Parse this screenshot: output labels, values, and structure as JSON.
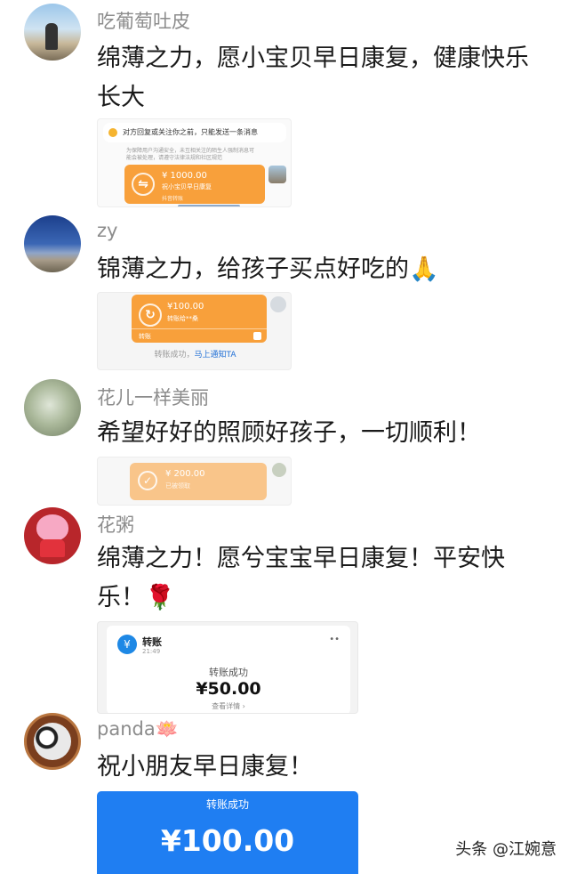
{
  "comments": [
    {
      "username": "吃葡萄吐皮",
      "text": "绵薄之力，愿小宝贝早日康复，健康快乐长大",
      "screenshot": {
        "notice": "对方回复或关注你之前，只能发送一条消息",
        "warning_line1": "为保障用户沟通安全，未互相关注的陌生人强制消息可",
        "warning_line2": "能会被处理，请遵守法律法规和社区规范",
        "amount": "¥ 1000.00",
        "note": "祝小宝贝早日康复",
        "status": "抖音转账"
      }
    },
    {
      "username": "zy",
      "text": "锦薄之力，给孩子买点好吃的🙏",
      "screenshot": {
        "amount": "¥100.00",
        "note": "转账给**桑",
        "type": "转账",
        "result": "转账成功，",
        "notify_link": "马上通知TA"
      }
    },
    {
      "username": "花儿一样美丽",
      "text": "希望好好的照顾好孩子，一切顺利！",
      "screenshot": {
        "amount": "¥ 200.00",
        "note": "已被领取"
      }
    },
    {
      "username": "花粥",
      "text": "绵薄之力！愿兮宝宝早日康复！平安快乐！🌹",
      "screenshot": {
        "title": "转账",
        "time": "21:49",
        "status": "转账成功",
        "amount": "¥50.00",
        "detail_link": "查看详情 ›"
      }
    },
    {
      "username": "panda🪷",
      "text": "祝小朋友早日康复！",
      "screenshot": {
        "status": "转账成功",
        "amount": "¥100.00"
      }
    }
  ],
  "watermark": "头条 @江婉意",
  "colors": {
    "orange": "#f8a03b",
    "blue": "#1f7ef2",
    "link": "#1f6fd6"
  }
}
